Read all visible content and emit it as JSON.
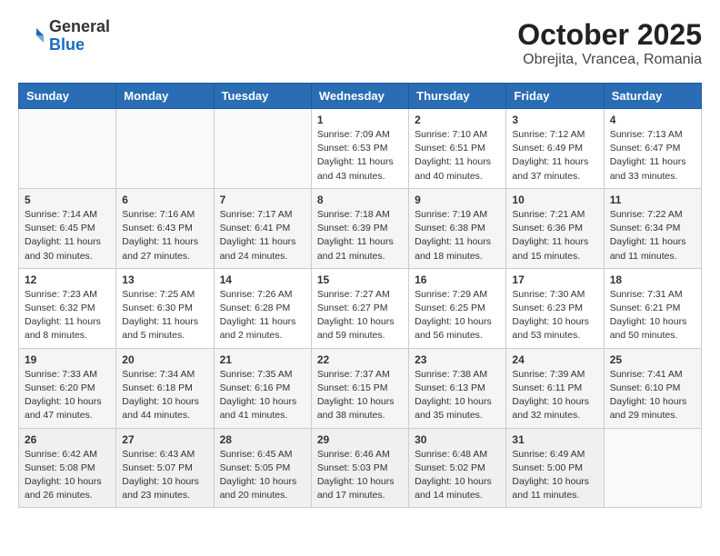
{
  "header": {
    "logo_general": "General",
    "logo_blue": "Blue",
    "month_title": "October 2025",
    "location": "Obrejita, Vrancea, Romania"
  },
  "weekdays": [
    "Sunday",
    "Monday",
    "Tuesday",
    "Wednesday",
    "Thursday",
    "Friday",
    "Saturday"
  ],
  "weeks": [
    [
      {
        "day": "",
        "info": ""
      },
      {
        "day": "",
        "info": ""
      },
      {
        "day": "",
        "info": ""
      },
      {
        "day": "1",
        "info": "Sunrise: 7:09 AM\nSunset: 6:53 PM\nDaylight: 11 hours and 43 minutes."
      },
      {
        "day": "2",
        "info": "Sunrise: 7:10 AM\nSunset: 6:51 PM\nDaylight: 11 hours and 40 minutes."
      },
      {
        "day": "3",
        "info": "Sunrise: 7:12 AM\nSunset: 6:49 PM\nDaylight: 11 hours and 37 minutes."
      },
      {
        "day": "4",
        "info": "Sunrise: 7:13 AM\nSunset: 6:47 PM\nDaylight: 11 hours and 33 minutes."
      }
    ],
    [
      {
        "day": "5",
        "info": "Sunrise: 7:14 AM\nSunset: 6:45 PM\nDaylight: 11 hours and 30 minutes."
      },
      {
        "day": "6",
        "info": "Sunrise: 7:16 AM\nSunset: 6:43 PM\nDaylight: 11 hours and 27 minutes."
      },
      {
        "day": "7",
        "info": "Sunrise: 7:17 AM\nSunset: 6:41 PM\nDaylight: 11 hours and 24 minutes."
      },
      {
        "day": "8",
        "info": "Sunrise: 7:18 AM\nSunset: 6:39 PM\nDaylight: 11 hours and 21 minutes."
      },
      {
        "day": "9",
        "info": "Sunrise: 7:19 AM\nSunset: 6:38 PM\nDaylight: 11 hours and 18 minutes."
      },
      {
        "day": "10",
        "info": "Sunrise: 7:21 AM\nSunset: 6:36 PM\nDaylight: 11 hours and 15 minutes."
      },
      {
        "day": "11",
        "info": "Sunrise: 7:22 AM\nSunset: 6:34 PM\nDaylight: 11 hours and 11 minutes."
      }
    ],
    [
      {
        "day": "12",
        "info": "Sunrise: 7:23 AM\nSunset: 6:32 PM\nDaylight: 11 hours and 8 minutes."
      },
      {
        "day": "13",
        "info": "Sunrise: 7:25 AM\nSunset: 6:30 PM\nDaylight: 11 hours and 5 minutes."
      },
      {
        "day": "14",
        "info": "Sunrise: 7:26 AM\nSunset: 6:28 PM\nDaylight: 11 hours and 2 minutes."
      },
      {
        "day": "15",
        "info": "Sunrise: 7:27 AM\nSunset: 6:27 PM\nDaylight: 10 hours and 59 minutes."
      },
      {
        "day": "16",
        "info": "Sunrise: 7:29 AM\nSunset: 6:25 PM\nDaylight: 10 hours and 56 minutes."
      },
      {
        "day": "17",
        "info": "Sunrise: 7:30 AM\nSunset: 6:23 PM\nDaylight: 10 hours and 53 minutes."
      },
      {
        "day": "18",
        "info": "Sunrise: 7:31 AM\nSunset: 6:21 PM\nDaylight: 10 hours and 50 minutes."
      }
    ],
    [
      {
        "day": "19",
        "info": "Sunrise: 7:33 AM\nSunset: 6:20 PM\nDaylight: 10 hours and 47 minutes."
      },
      {
        "day": "20",
        "info": "Sunrise: 7:34 AM\nSunset: 6:18 PM\nDaylight: 10 hours and 44 minutes."
      },
      {
        "day": "21",
        "info": "Sunrise: 7:35 AM\nSunset: 6:16 PM\nDaylight: 10 hours and 41 minutes."
      },
      {
        "day": "22",
        "info": "Sunrise: 7:37 AM\nSunset: 6:15 PM\nDaylight: 10 hours and 38 minutes."
      },
      {
        "day": "23",
        "info": "Sunrise: 7:38 AM\nSunset: 6:13 PM\nDaylight: 10 hours and 35 minutes."
      },
      {
        "day": "24",
        "info": "Sunrise: 7:39 AM\nSunset: 6:11 PM\nDaylight: 10 hours and 32 minutes."
      },
      {
        "day": "25",
        "info": "Sunrise: 7:41 AM\nSunset: 6:10 PM\nDaylight: 10 hours and 29 minutes."
      }
    ],
    [
      {
        "day": "26",
        "info": "Sunrise: 6:42 AM\nSunset: 5:08 PM\nDaylight: 10 hours and 26 minutes."
      },
      {
        "day": "27",
        "info": "Sunrise: 6:43 AM\nSunset: 5:07 PM\nDaylight: 10 hours and 23 minutes."
      },
      {
        "day": "28",
        "info": "Sunrise: 6:45 AM\nSunset: 5:05 PM\nDaylight: 10 hours and 20 minutes."
      },
      {
        "day": "29",
        "info": "Sunrise: 6:46 AM\nSunset: 5:03 PM\nDaylight: 10 hours and 17 minutes."
      },
      {
        "day": "30",
        "info": "Sunrise: 6:48 AM\nSunset: 5:02 PM\nDaylight: 10 hours and 14 minutes."
      },
      {
        "day": "31",
        "info": "Sunrise: 6:49 AM\nSunset: 5:00 PM\nDaylight: 10 hours and 11 minutes."
      },
      {
        "day": "",
        "info": ""
      }
    ]
  ]
}
